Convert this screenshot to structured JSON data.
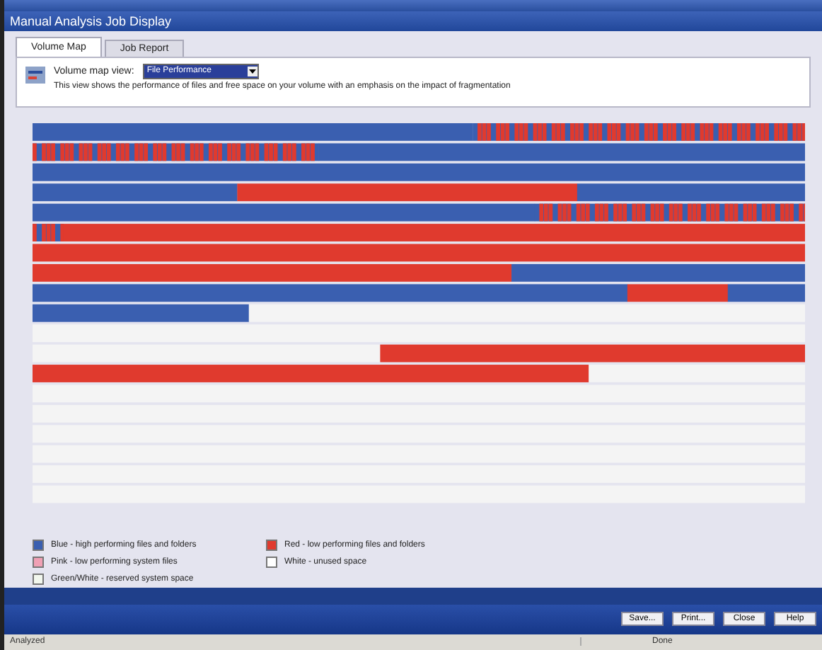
{
  "window": {
    "title": "Manual Analysis Job Display"
  },
  "tabs": [
    {
      "label": "Volume Map",
      "selected": true
    },
    {
      "label": "Job Report",
      "selected": false
    }
  ],
  "view": {
    "label": "Volume map view:",
    "value": "File Performance",
    "description": "This view shows the performance of files and free space on your volume with an emphasis on the impact of fragmentation"
  },
  "legend": [
    {
      "label": "Blue - high performing files and folders",
      "color": "#3a5fb0"
    },
    {
      "label": "Pink - low performing system files",
      "color": "#f0a0b4"
    },
    {
      "label": "Green/White - reserved system space",
      "color": "#f2f7ee"
    },
    {
      "label": "Red - low performing files and folders",
      "color": "#e03a2e"
    },
    {
      "label": "White - unused space",
      "color": "#ffffff"
    }
  ],
  "buttons": [
    "Save...",
    "Print...",
    "Close",
    "Help"
  ],
  "status_bar": {
    "left": "Analyzed",
    "right": "Done"
  }
}
